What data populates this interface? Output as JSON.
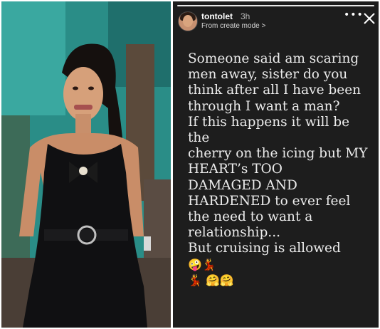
{
  "story": {
    "username": "tontolet",
    "time": "3h",
    "subtitle": "From create mode >",
    "more_icon": "more-options-icon",
    "close_icon": "close-icon",
    "caption": {
      "text": "Someone said am scaring\nmen away, sister do you\nthink after all I have been\nthrough I want a man?\nIf this happens it will be the\ncherry on the icing but MY\nHEART’s  TOO\nDAMAGED AND\nHARDENED to ever feel\nthe need to want a\nrelationship...\nBut cruising is allowed",
      "emojis_line1": "🤪💃",
      "emojis_line2": "💃 🤗🤗"
    }
  },
  "colors": {
    "story_background": "#1d1d1d",
    "photo_background": "#2a8d87"
  }
}
